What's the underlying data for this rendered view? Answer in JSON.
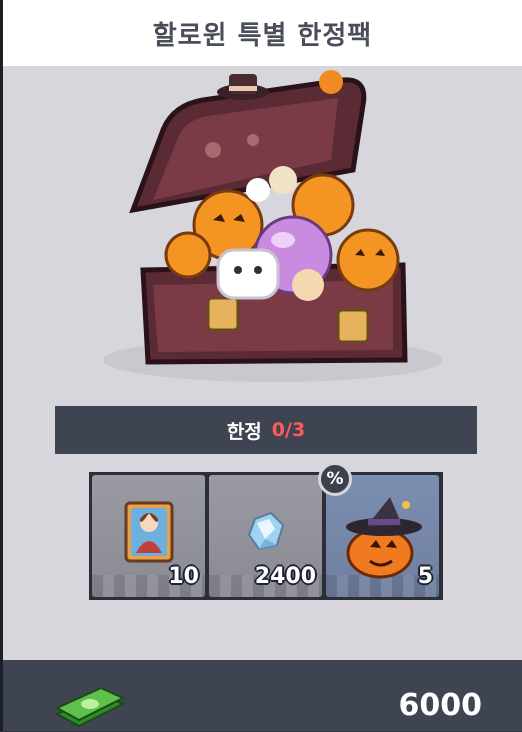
{
  "header": {
    "title": "할로윈 특별 한정팩"
  },
  "limit": {
    "label": "한정",
    "value": "0/3"
  },
  "items": [
    {
      "icon": "character-card-icon",
      "quantity": "10"
    },
    {
      "icon": "crystal-gem-icon",
      "quantity": "2400"
    },
    {
      "icon": "pumpkin-witch-hat-icon",
      "quantity": "5"
    }
  ],
  "discount_badge": "%",
  "footer": {
    "currency_icon": "cash-stack-icon",
    "price": "6000"
  },
  "colors": {
    "limit_value": "#ff5a5a",
    "bar": "#3f4452",
    "card_bg": "#d7d6dd"
  }
}
